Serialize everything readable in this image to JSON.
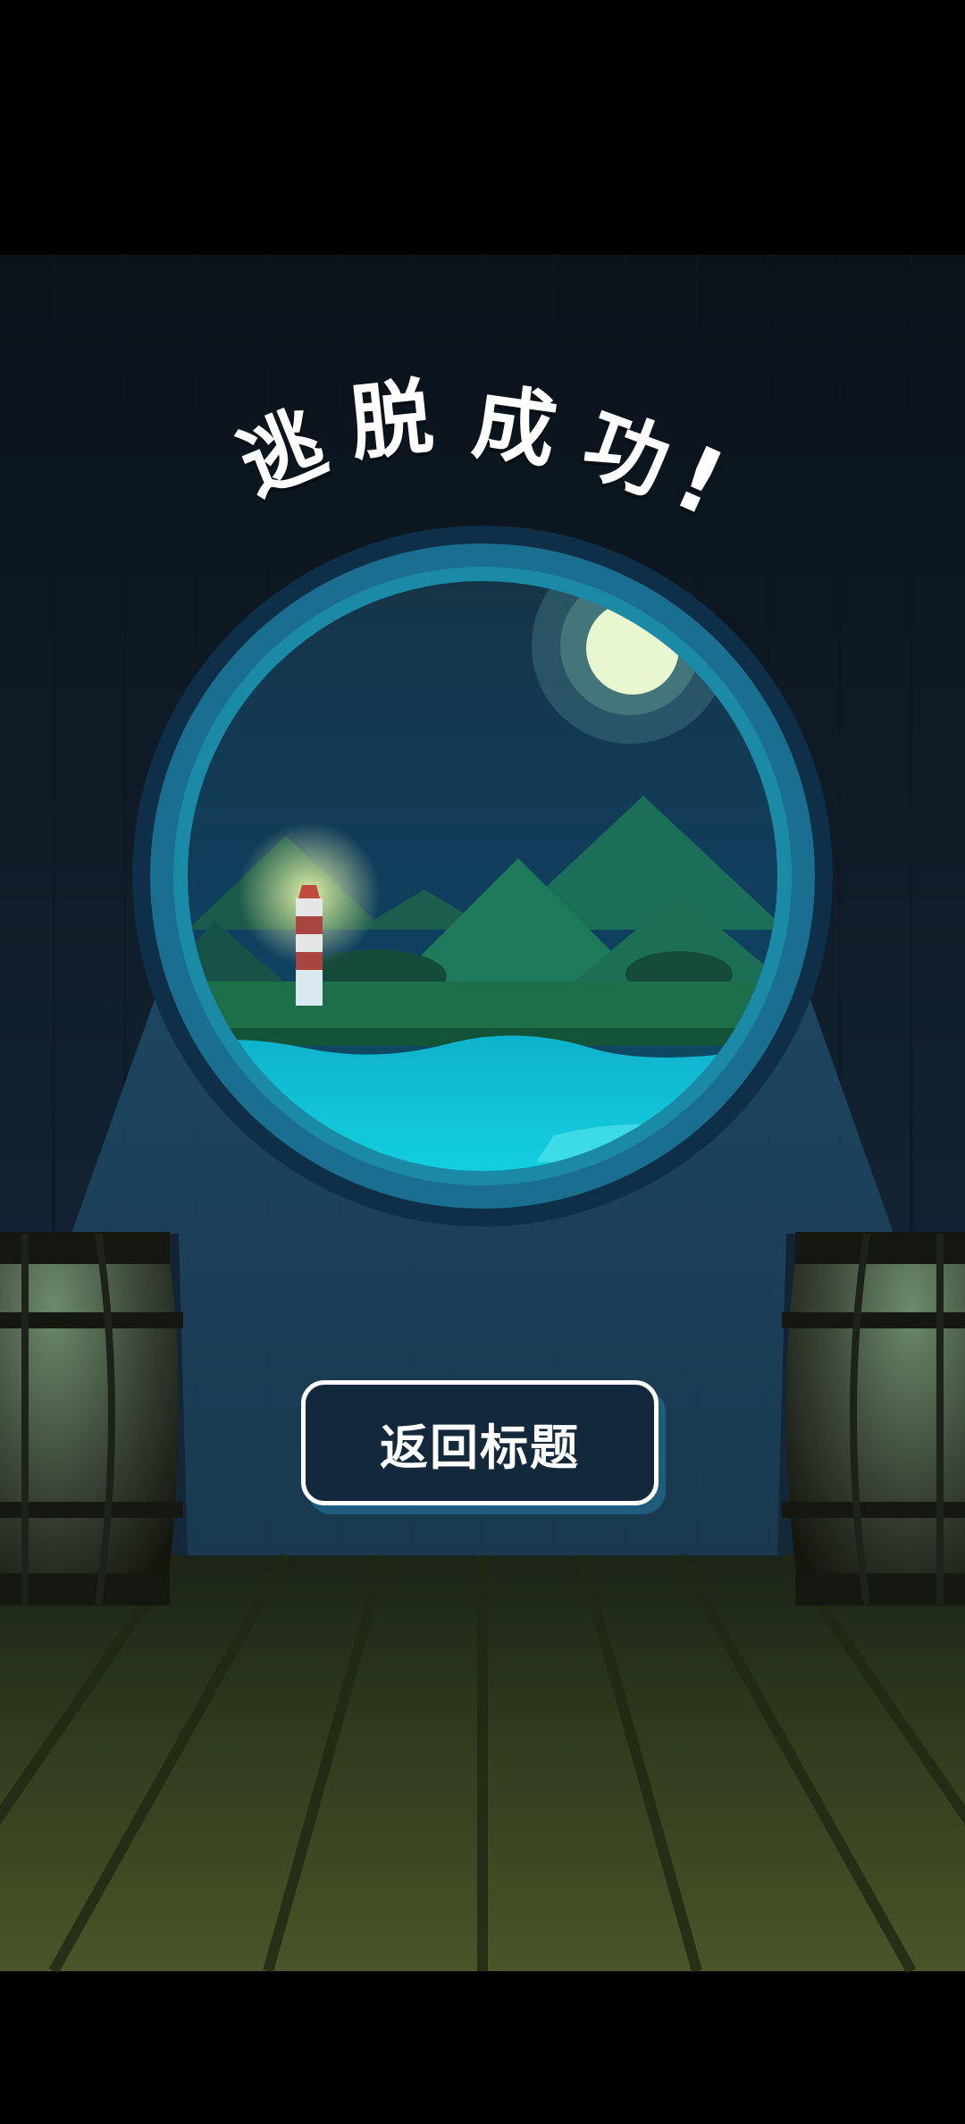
{
  "screen": {
    "title_chars": [
      "逃",
      "脱",
      "成",
      "功",
      "!"
    ],
    "return_button_label": "返回标题"
  },
  "colors": {
    "wall": "#11202c",
    "floor": "#3f4a26",
    "porthole_ring": "#1a6f90",
    "water": "#13c9dc",
    "moon": "#e9f7d0",
    "button_bg": "#13283a",
    "button_border": "#ffffff"
  },
  "icons": [
    "moon-icon",
    "lighthouse-icon",
    "barrel-icon"
  ]
}
